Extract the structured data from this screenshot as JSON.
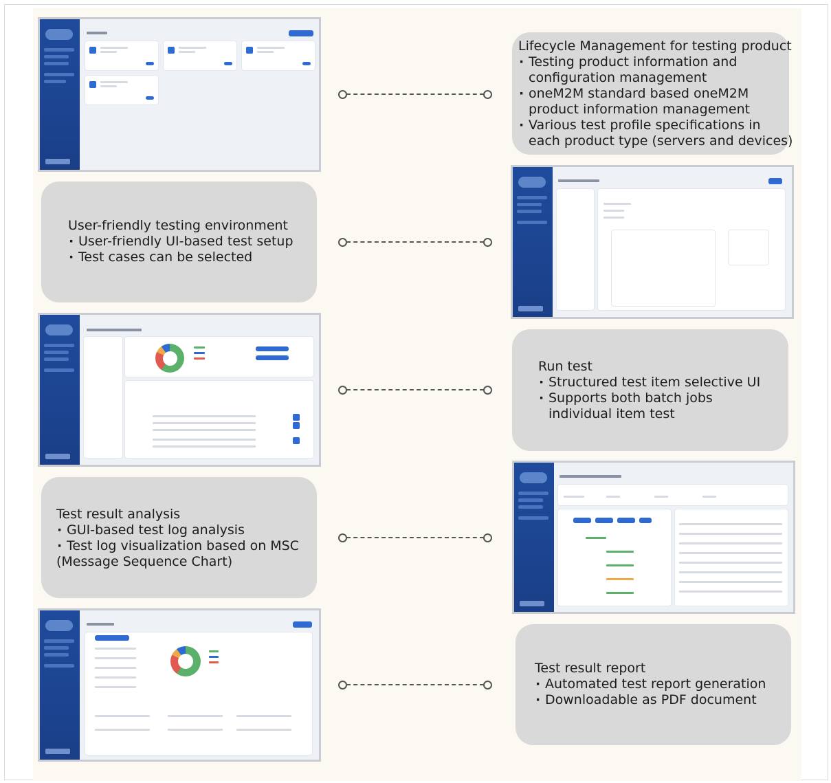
{
  "boxes": {
    "lifecycle": {
      "title": "Lifecycle Management for testing product",
      "items": [
        "Testing product information and",
        "configuration management",
        "oneM2M standard based oneM2M",
        "product information management",
        "Various test profile specifications in",
        "each product type (servers and devices)"
      ]
    },
    "user_friendly": {
      "title": "User-friendly testing environment",
      "items": [
        "User-friendly UI-based test setup",
        "Test cases can be selected"
      ]
    },
    "run_test": {
      "title": "Run test",
      "items": [
        "Structured test item selective UI",
        "Supports both batch jobs",
        "individual item test"
      ]
    },
    "analysis": {
      "title": "Test result analysis",
      "items": [
        "GUI-based test log analysis",
        "Test log visualization based on MSC",
        "(Message Sequence Chart)"
      ]
    },
    "report": {
      "title": "Test result report",
      "items": [
        "Automated test report generation",
        "Downloadable as PDF document"
      ]
    }
  },
  "screenshots": [
    "product-list",
    "test-case-selection",
    "test-run",
    "msc-log-analysis",
    "test-report"
  ],
  "colors": {
    "box_bg": "#d9d9d9",
    "panel_bg": "#fbf9f1",
    "sidebar": "#1f4b9c",
    "accent": "#2e6ad1",
    "connector": "#555555"
  }
}
